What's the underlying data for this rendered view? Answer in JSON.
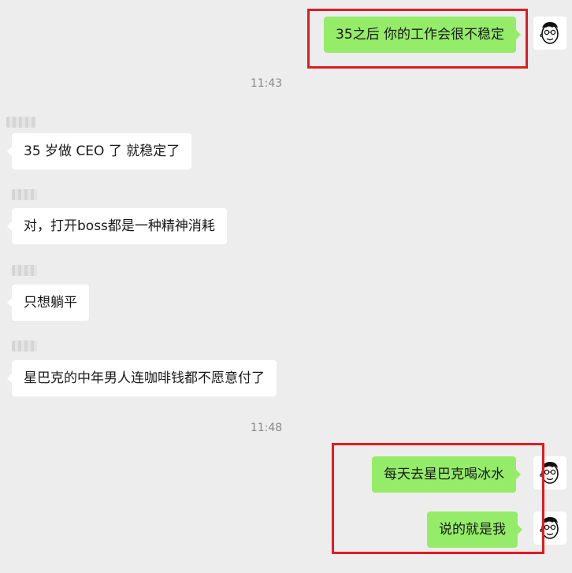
{
  "chat": {
    "accent_outgoing": "#95ec69",
    "accent_incoming": "#ffffff",
    "highlight_color": "#e11b22",
    "timestamps": [
      "11:43",
      "11:48"
    ],
    "messages": [
      {
        "direction": "out",
        "text": "35之后 你的工作会很不稳定",
        "avatar_icon": "cartoon-man-avatar-icon"
      },
      {
        "direction": "in",
        "text": "35 岁做 CEO 了 就稳定了"
      },
      {
        "direction": "in",
        "text": "对，打开boss都是一种精神消耗"
      },
      {
        "direction": "in",
        "text": "只想躺平"
      },
      {
        "direction": "in",
        "text": "星巴克的中年男人连咖啡钱都不愿意付了"
      },
      {
        "direction": "out",
        "text": "每天去星巴克喝冰水",
        "avatar_icon": "cartoon-man-avatar-icon"
      },
      {
        "direction": "out",
        "text": "说的就是我",
        "avatar_icon": "cartoon-man-avatar-icon"
      }
    ]
  }
}
